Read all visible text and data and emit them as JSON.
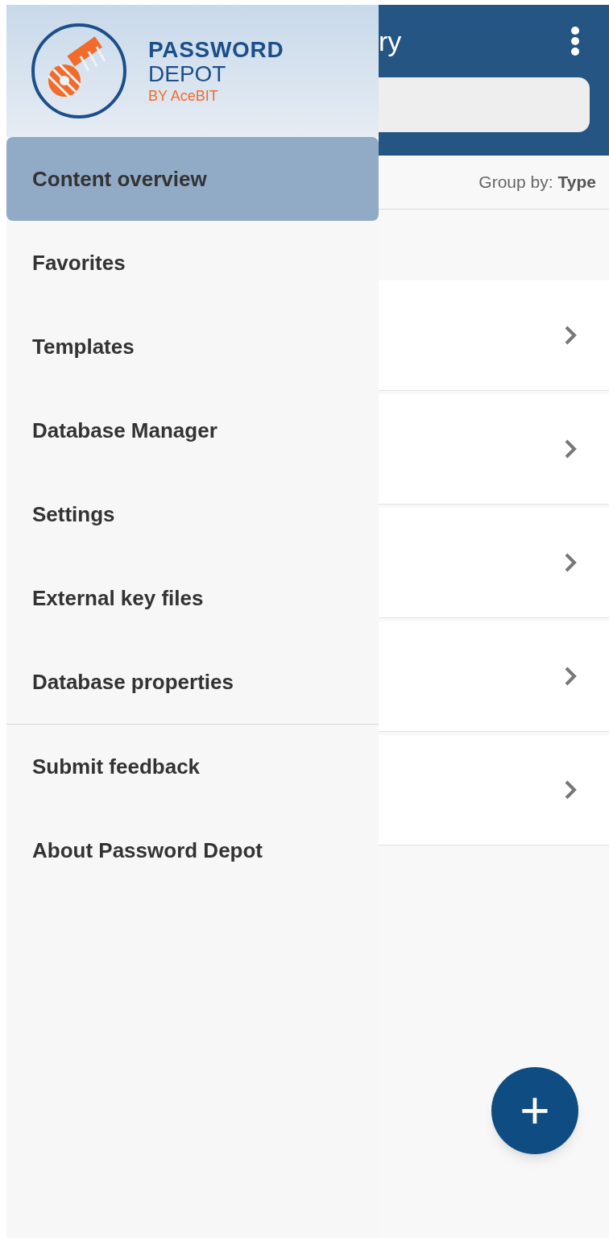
{
  "drawer": {
    "logo": {
      "line1": "PASSWORD",
      "line2": "DEPOT",
      "line3": "BY AceBIT"
    },
    "sections": [
      {
        "items": [
          {
            "label": "Content overview",
            "selected": true
          },
          {
            "label": "Favorites",
            "selected": false
          },
          {
            "label": "Templates",
            "selected": false
          },
          {
            "label": "Database Manager",
            "selected": false
          },
          {
            "label": "Settings",
            "selected": false
          },
          {
            "label": "External key files",
            "selected": false
          },
          {
            "label": "Database properties",
            "selected": false
          }
        ]
      },
      {
        "items": [
          {
            "label": "Submit feedback",
            "selected": false
          },
          {
            "label": "About Password Depot",
            "selected": false
          }
        ]
      }
    ]
  },
  "main": {
    "title": "ry",
    "group_by": {
      "label": "Group by:",
      "value": "Type"
    },
    "rows": [
      {
        "kind": "row"
      },
      {
        "kind": "row"
      },
      {
        "kind": "row"
      },
      {
        "kind": "row"
      },
      {
        "kind": "row"
      }
    ],
    "fab": {
      "label": "+"
    }
  }
}
